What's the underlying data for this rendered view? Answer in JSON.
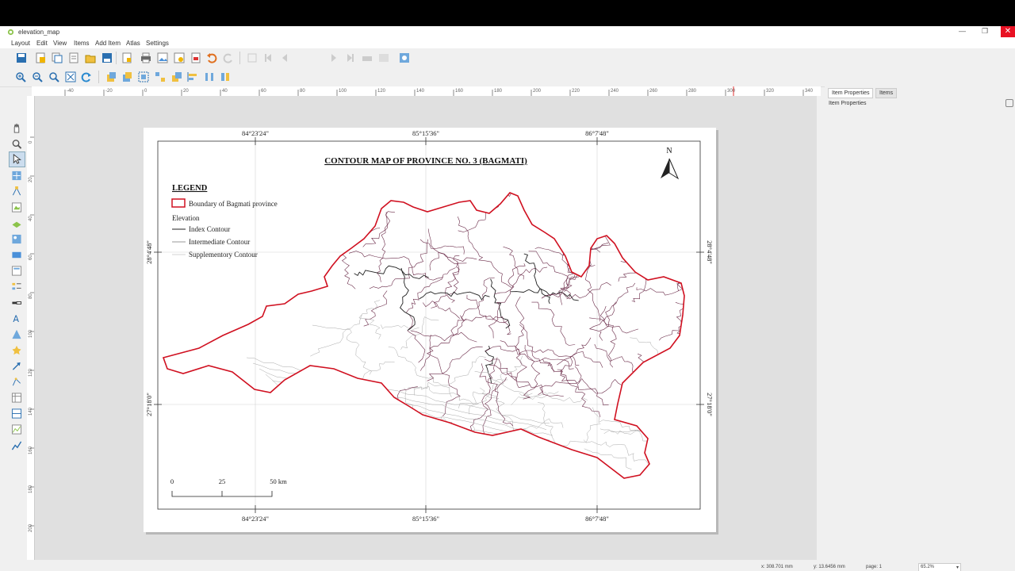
{
  "window": {
    "title": "elevation_map",
    "minimize": "—",
    "restore": "❐",
    "close": "✕"
  },
  "menu": [
    "Layout",
    "Edit",
    "View",
    "Items",
    "Add Item",
    "Atlas",
    "Settings"
  ],
  "toolbar": {
    "page_number": "1"
  },
  "hruler_ticks": [
    "-40",
    "-20",
    "0",
    "20",
    "40",
    "60",
    "80",
    "100",
    "120",
    "140",
    "160",
    "180",
    "200",
    "220",
    "240",
    "260",
    "280",
    "300",
    "320",
    "340"
  ],
  "vruler_ticks": [
    "0",
    "20",
    "40",
    "60",
    "80",
    "100",
    "120",
    "140",
    "160",
    "180",
    "200",
    "220"
  ],
  "panel": {
    "tab_item_properties": "Item Properties",
    "tab_items": "Items",
    "header": "Item Properties"
  },
  "status": {
    "x": "x: 308.701 mm",
    "y": "y: 13.6456 mm",
    "page": "page: 1",
    "zoom": "65.2%"
  },
  "map": {
    "title": "CONTOUR MAP OF PROVINCE NO. 3 (BAGMATI)",
    "legend_title": "LEGEND",
    "legend_boundary": "Boundary of Bagmati province",
    "legend_elevation": "Elevation",
    "legend_index": "Index Contour",
    "legend_intermediate": "Intermediate Contour",
    "legend_supplementary": "Supplementory Contour",
    "north": "N",
    "grid_top": [
      "84°23'24\"",
      "85°15'36\"",
      "86°7'48\""
    ],
    "grid_bottom": [
      "84°23'24\"",
      "85°15'36\"",
      "86°7'48\""
    ],
    "grid_left": [
      "28°4'48\"",
      "27°18'0\""
    ],
    "grid_right": [
      "28°4'48\"",
      "27°18'0\""
    ],
    "scale": [
      "0",
      "25",
      "50 km"
    ],
    "colors": {
      "boundary": "#d01020",
      "index": "#222222",
      "intermediate": "#6a2a48",
      "supplementary": "#a8a8a8"
    }
  }
}
